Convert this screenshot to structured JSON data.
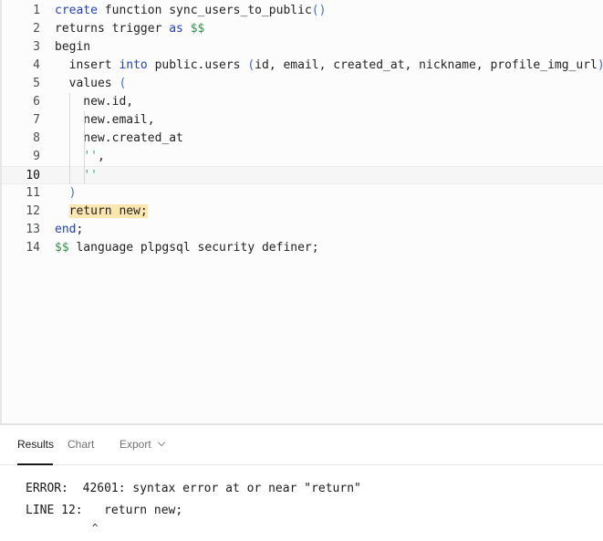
{
  "editor": {
    "line_numbers": [
      "1",
      "2",
      "3",
      "4",
      "5",
      "6",
      "7",
      "8",
      "9",
      "10",
      "11",
      "12",
      "13",
      "14"
    ],
    "lines": [
      [
        {
          "t": "create",
          "c": "kw"
        },
        {
          "t": " function sync_users_to_public"
        },
        {
          "t": "()",
          "c": "paren"
        }
      ],
      [
        {
          "t": "returns trigger "
        },
        {
          "t": "as",
          "c": "kw"
        },
        {
          "t": " "
        },
        {
          "t": "$$",
          "c": "dl"
        }
      ],
      [
        {
          "t": "begin"
        }
      ],
      [
        {
          "t": "  insert "
        },
        {
          "t": "into",
          "c": "kw"
        },
        {
          "t": " public.users "
        },
        {
          "t": "(",
          "c": "paren"
        },
        {
          "t": "id, email, created_at, nickname, profile_img_url"
        },
        {
          "t": ")",
          "c": "paren"
        }
      ],
      [
        {
          "t": "  values "
        },
        {
          "t": "(",
          "c": "paren"
        }
      ],
      [
        {
          "t": "    new.id,"
        }
      ],
      [
        {
          "t": "    new.email,"
        }
      ],
      [
        {
          "t": "    new.created_at"
        }
      ],
      [
        {
          "t": "    "
        },
        {
          "t": "''",
          "c": "str"
        },
        {
          "t": ","
        }
      ],
      [
        {
          "t": "    "
        },
        {
          "t": "''",
          "c": "str"
        }
      ],
      [
        {
          "t": "  "
        },
        {
          "t": ")",
          "c": "paren"
        }
      ],
      [
        {
          "t": "  "
        },
        {
          "t": "return new;",
          "c": "hl"
        }
      ],
      [
        {
          "t": "end",
          "c": "kw"
        },
        {
          "t": ";"
        }
      ],
      [
        {
          "t": "$$",
          "c": "dl"
        },
        {
          "t": " language plpgsql security definer;"
        }
      ]
    ],
    "current_line": 10,
    "error_line": 12
  },
  "results_panel": {
    "tabs": [
      {
        "label": "Results",
        "active": true
      },
      {
        "label": "Chart",
        "active": false
      },
      {
        "label": "Export",
        "active": false,
        "dropdown": true
      }
    ],
    "error_lines": [
      "ERROR:  42601: syntax error at or near \"return\"",
      "LINE 12:   return new;",
      "           ^"
    ]
  },
  "colors": {
    "keyword": "#1f3fbf",
    "dollar_quote": "#2f8f4a",
    "paren": "#3b6fd6",
    "string": "#3fa870",
    "error_highlight": "#fbe6b0"
  }
}
